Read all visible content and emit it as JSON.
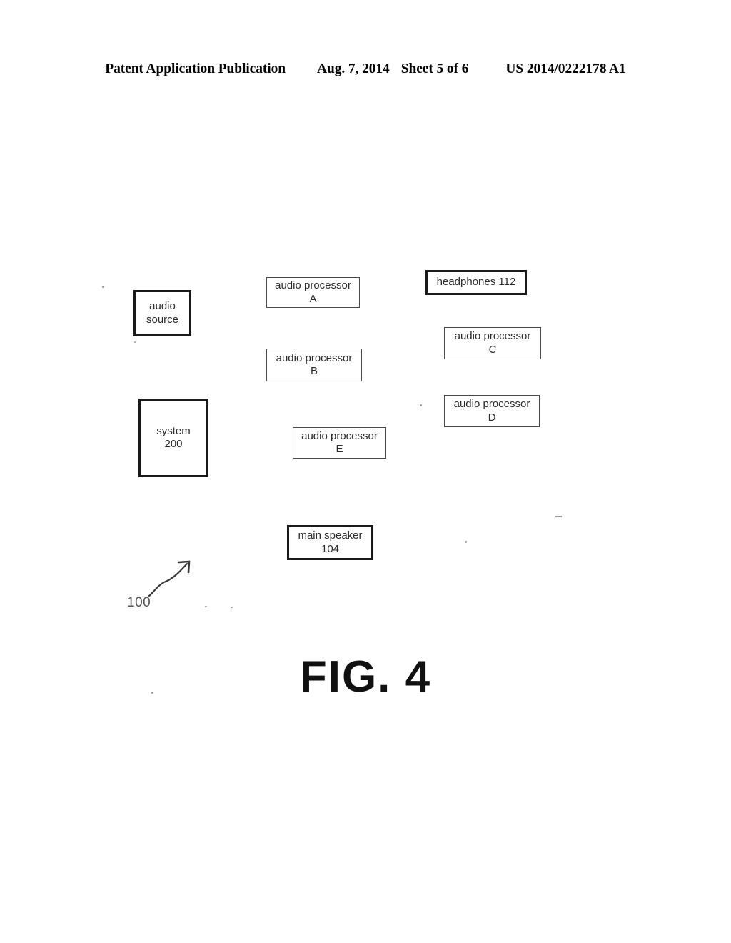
{
  "header": {
    "publication": "Patent Application Publication",
    "date": "Aug. 7, 2014",
    "sheet": "Sheet 5 of 6",
    "patent_number": "US 2014/0222178 A1"
  },
  "figure": {
    "caption": "FIG. 4",
    "reference_numeral": "100",
    "nodes": [
      {
        "id": "audio-source",
        "line1": "audio",
        "line2": "source",
        "border": "bold"
      },
      {
        "id": "proc-a",
        "line1": "audio processor",
        "line2": "A",
        "border": "thin"
      },
      {
        "id": "proc-b",
        "line1": "audio processor",
        "line2": "B",
        "border": "thin"
      },
      {
        "id": "headphones",
        "line1": "headphones 112",
        "line2": "",
        "border": "bold"
      },
      {
        "id": "proc-c",
        "line1": "audio processor",
        "line2": "C",
        "border": "thin"
      },
      {
        "id": "proc-d",
        "line1": "audio processor",
        "line2": "D",
        "border": "thin"
      },
      {
        "id": "system",
        "line1": "system",
        "line2": "200",
        "border": "bold"
      },
      {
        "id": "proc-e",
        "line1": "audio processor",
        "line2": "E",
        "border": "thin"
      },
      {
        "id": "main-speaker",
        "line1": "main speaker",
        "line2": "104",
        "border": "bold"
      }
    ]
  },
  "colors": {
    "page_background": "#ffffff",
    "ink": "#1a1a1a",
    "thin_border": "#4a4a4a",
    "box_text": "#2b2b2b",
    "numeral_text": "#555555"
  }
}
